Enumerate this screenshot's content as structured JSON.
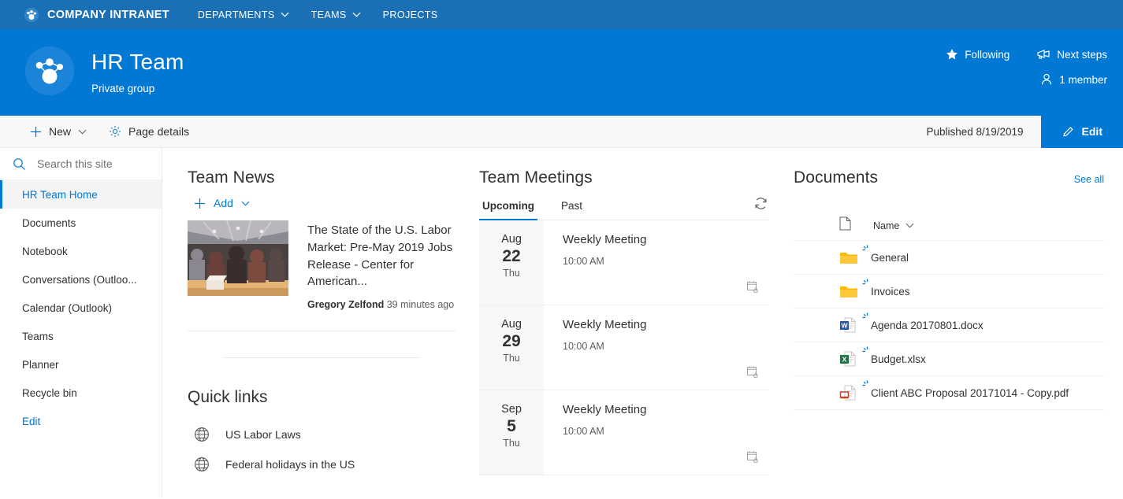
{
  "topnav": {
    "brand": "COMPANY INTRANET",
    "logo_icon": "group-network-icon",
    "items": [
      {
        "label": "DEPARTMENTS",
        "has_chevron": true
      },
      {
        "label": "TEAMS",
        "has_chevron": true
      },
      {
        "label": "PROJECTS",
        "has_chevron": false
      }
    ]
  },
  "hero": {
    "logo_icon": "group-network-icon",
    "title": "HR Team",
    "subtitle": "Private group",
    "following_label": "Following",
    "following_icon": "star-filled-icon",
    "next_steps_label": "Next steps",
    "next_steps_icon": "megaphone-icon",
    "members_label": "1 member",
    "members_icon": "person-icon"
  },
  "commandbar": {
    "new_label": "New",
    "new_icon": "plus-icon",
    "page_details_label": "Page details",
    "page_details_icon": "gear-icon",
    "published_label": "Published 8/19/2019",
    "edit_label": "Edit",
    "edit_icon": "pencil-icon"
  },
  "search": {
    "placeholder": "Search this site",
    "icon": "search-icon",
    "value": ""
  },
  "sidebar": {
    "items": [
      {
        "label": "HR Team Home",
        "active": true,
        "is_link": false
      },
      {
        "label": "Documents",
        "active": false,
        "is_link": false
      },
      {
        "label": "Notebook",
        "active": false,
        "is_link": false
      },
      {
        "label": "Conversations (Outloo...",
        "active": false,
        "is_link": false
      },
      {
        "label": "Calendar (Outlook)",
        "active": false,
        "is_link": false
      },
      {
        "label": "Teams",
        "active": false,
        "is_link": false
      },
      {
        "label": "Planner",
        "active": false,
        "is_link": false
      },
      {
        "label": "Recycle bin",
        "active": false,
        "is_link": false
      },
      {
        "label": "Edit",
        "active": false,
        "is_link": true
      }
    ]
  },
  "news": {
    "title": "Team News",
    "add_label": "Add",
    "add_icon": "plus-icon",
    "items": [
      {
        "headline": "The State of the U.S. Labor Market: Pre-May 2019 Jobs Release - Center for American...",
        "author": "Gregory Zelfond",
        "time": "39 minutes ago",
        "thumbnail": "conference-audience-photo"
      }
    ]
  },
  "quicklinks": {
    "title": "Quick links",
    "items": [
      {
        "label": "US Labor Laws",
        "icon": "globe-icon"
      },
      {
        "label": "Federal holidays in the US",
        "icon": "globe-icon"
      }
    ]
  },
  "meetings": {
    "title": "Team Meetings",
    "refresh_icon": "refresh-icon",
    "tabs": [
      {
        "label": "Upcoming",
        "active": true
      },
      {
        "label": "Past",
        "active": false
      }
    ],
    "items": [
      {
        "month": "Aug",
        "day": "22",
        "weekday": "Thu",
        "title": "Weekly Meeting",
        "time": "10:00 AM",
        "recurring_icon": "recurring-calendar-icon"
      },
      {
        "month": "Aug",
        "day": "29",
        "weekday": "Thu",
        "title": "Weekly Meeting",
        "time": "10:00 AM",
        "recurring_icon": "recurring-calendar-icon"
      },
      {
        "month": "Sep",
        "day": "5",
        "weekday": "Thu",
        "title": "Weekly Meeting",
        "time": "10:00 AM",
        "recurring_icon": "recurring-calendar-icon"
      }
    ]
  },
  "documents": {
    "title": "Documents",
    "see_all_label": "See all",
    "column_icon": "document-icon",
    "column_name": "Name",
    "sort_icon": "chevron-down-icon",
    "rows": [
      {
        "name": "General",
        "type": "folder",
        "icon": "folder-icon",
        "is_new": true
      },
      {
        "name": "Invoices",
        "type": "folder",
        "icon": "folder-icon",
        "is_new": true
      },
      {
        "name": "Agenda 20170801.docx",
        "type": "word",
        "icon": "word-icon",
        "is_new": true
      },
      {
        "name": "Budget.xlsx",
        "type": "excel",
        "icon": "excel-icon",
        "is_new": true
      },
      {
        "name": "Client ABC Proposal 20171014 - Copy.pdf",
        "type": "pdf",
        "icon": "pdf-icon",
        "is_new": true
      }
    ]
  },
  "colors": {
    "topnav_blue": "#1a6fb5",
    "hero_blue": "#0078d4",
    "accent": "#0078d4",
    "folder_yellow": "#ffb900",
    "word_blue": "#2b579a",
    "excel_green": "#217346",
    "pdf_red": "#b7472a"
  }
}
